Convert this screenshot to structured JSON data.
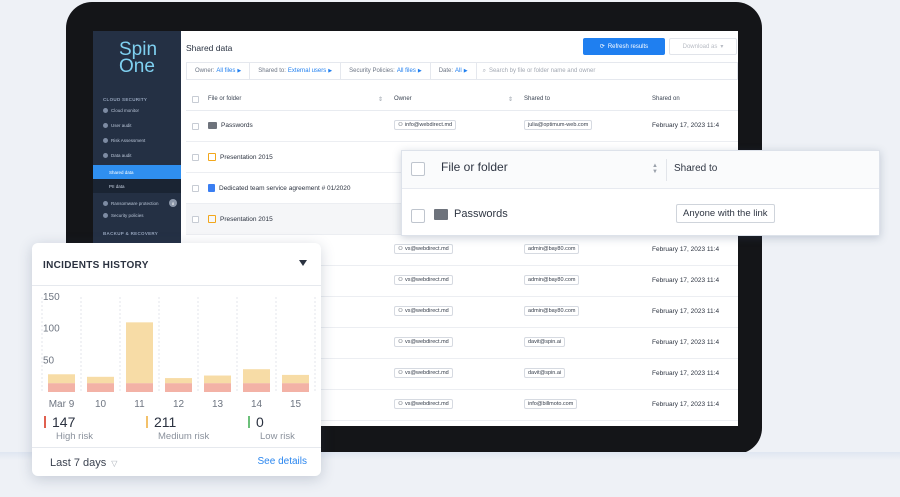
{
  "app": {
    "logo_line1": "Spin",
    "logo_line2": "One",
    "page_title": "Shared data",
    "refresh_label": "Refresh results",
    "download_label": "Download as"
  },
  "sidebar": {
    "section1": "CLOUD SECURITY",
    "items": [
      {
        "label": "Cloud monitor"
      },
      {
        "label": "User audit"
      },
      {
        "label": "Risk Assessment"
      },
      {
        "label": "Data audit"
      },
      {
        "label": "Shared data"
      },
      {
        "label": "PII data"
      },
      {
        "label": "Ransomware protection",
        "badge": "8"
      },
      {
        "label": "Security policies"
      }
    ],
    "section2": "BACKUP & RECOVERY"
  },
  "filters": {
    "owner_label": "Owner:",
    "owner_value": "All files",
    "shared_label": "Shared to:",
    "shared_value": "External users",
    "policy_label": "Security Policies:",
    "policy_value": "All files",
    "date_label": "Date:",
    "date_value": "All",
    "search_placeholder": "Search by file or folder name and owner"
  },
  "table": {
    "headers": {
      "file": "File or folder",
      "owner": "Owner",
      "shared": "Shared to",
      "shared_on": "Shared on"
    },
    "rows": [
      {
        "file": "Passwords",
        "icon": "folder",
        "owner": "info@webdirect.md",
        "shared": "julia@optimum-web.com",
        "date": "February 17, 2023 11:4"
      },
      {
        "file": "Presentation 2015",
        "icon": "presentation",
        "owner": "",
        "shared": "",
        "date": ""
      },
      {
        "file": "Dedicated team service agreement # 01/2020",
        "icon": "doc",
        "owner": "",
        "shared": "",
        "date": ""
      },
      {
        "file": "Presentation 2015",
        "icon": "presentation",
        "owner": "",
        "shared": "",
        "date": ""
      },
      {
        "file": "",
        "icon": "",
        "owner": "vs@webdirect.md",
        "shared": "admin@bay80.com",
        "date": "February 17, 2023 11:4"
      },
      {
        "file": "",
        "icon": "",
        "owner": "vs@webdirect.md",
        "shared": "admin@bay80.com",
        "date": "February 17, 2023 11:4"
      },
      {
        "file": "",
        "icon": "",
        "owner": "vs@webdirect.md",
        "shared": "admin@bay80.com",
        "date": "February 17, 2023 11:4"
      },
      {
        "file": "",
        "icon": "",
        "owner": "vs@webdirect.md",
        "shared": "davit@spin.ai",
        "date": "February 17, 2023 11:4"
      },
      {
        "file": "",
        "icon": "",
        "owner": "vs@webdirect.md",
        "shared": "davit@spin.ai",
        "date": "February 17, 2023 11:4"
      },
      {
        "file": "",
        "icon": "",
        "owner": "vs@webdirect.md",
        "shared": "info@billmoto.com",
        "date": "February 17, 2023 11:4"
      }
    ]
  },
  "popout": {
    "col1": "File or folder",
    "col2": "Shared to",
    "row_file": "Passwords",
    "row_shared": "Anyone with the link"
  },
  "incidents": {
    "title": "INCIDENTS HISTORY",
    "period": "Last 7 days",
    "see_details": "See details",
    "stats": [
      {
        "value": "147",
        "label": "High risk",
        "color": "#e0604f"
      },
      {
        "value": "211",
        "label": "Medium risk",
        "color": "#f3c16a"
      },
      {
        "value": "0",
        "label": "Low risk",
        "color": "#6cc07a"
      }
    ]
  },
  "chart_data": {
    "type": "bar",
    "stacked": true,
    "categories": [
      "Mar 9",
      "10",
      "11",
      "12",
      "13",
      "14",
      "15"
    ],
    "series": [
      {
        "name": "High risk",
        "color": "#f3b2a6",
        "values": [
          14,
          14,
          14,
          14,
          14,
          14,
          14
        ]
      },
      {
        "name": "Medium risk",
        "color": "#f7dca6",
        "values": [
          14,
          10,
          96,
          8,
          12,
          22,
          13
        ]
      }
    ],
    "yticks": [
      50,
      100,
      150
    ],
    "ylim": [
      0,
      150
    ],
    "grid": "vertical-dashed"
  }
}
